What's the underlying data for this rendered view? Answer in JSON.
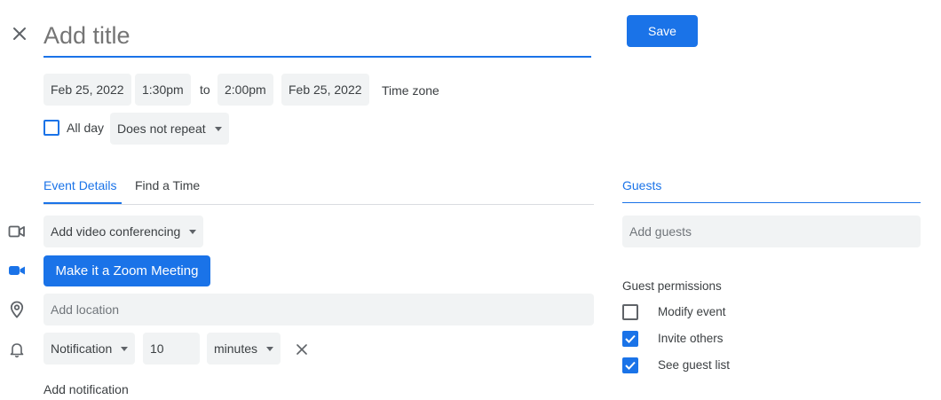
{
  "header": {
    "title_placeholder": "Add title",
    "save_label": "Save"
  },
  "datetime": {
    "start_date": "Feb 25, 2022",
    "start_time": "1:30pm",
    "to_label": "to",
    "end_time": "2:00pm",
    "end_date": "Feb 25, 2022",
    "timezone_label": "Time zone",
    "all_day_label": "All day",
    "all_day_checked": false,
    "repeat_value": "Does not repeat"
  },
  "tabs": [
    {
      "label": "Event Details",
      "active": true
    },
    {
      "label": "Find a Time",
      "active": false
    }
  ],
  "details": {
    "video_conferencing_label": "Add video conferencing",
    "zoom_button_label": "Make it a Zoom Meeting",
    "location_placeholder": "Add location",
    "notification_type": "Notification",
    "notification_amount": "10",
    "notification_unit": "minutes",
    "add_notification_label": "Add notification"
  },
  "guests": {
    "tab_label": "Guests",
    "input_placeholder": "Add guests",
    "permissions_title": "Guest permissions",
    "permissions": [
      {
        "label": "Modify event",
        "checked": false
      },
      {
        "label": "Invite others",
        "checked": true
      },
      {
        "label": "See guest list",
        "checked": true
      }
    ]
  },
  "colors": {
    "accent": "#1a73e8",
    "field_bg": "#f1f3f4",
    "text": "#3c4043",
    "icon": "#5f6368"
  }
}
